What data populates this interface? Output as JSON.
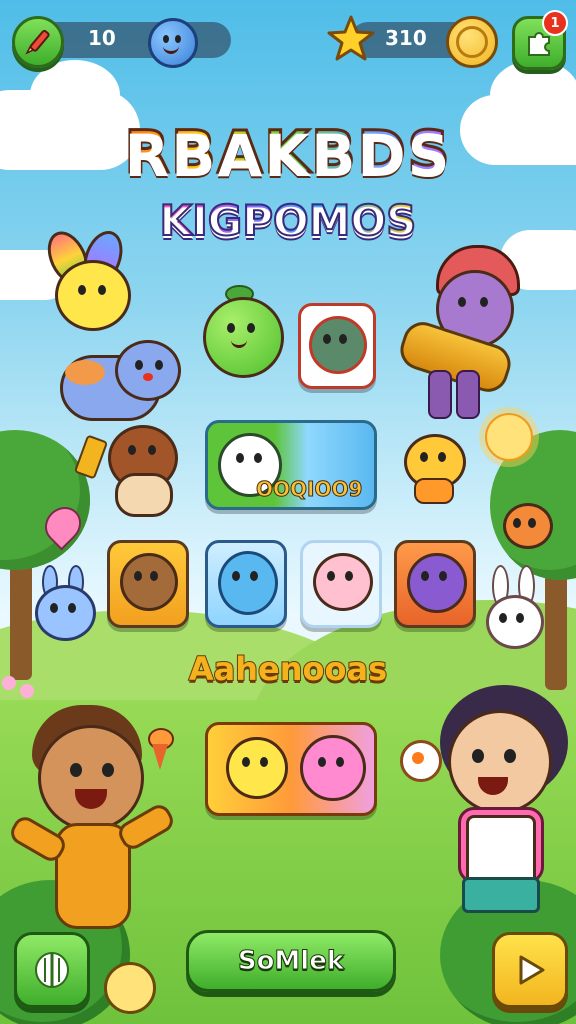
{
  "hud": {
    "left_counter": "10",
    "right_counter": "310",
    "notification_count": "1"
  },
  "titles": {
    "main": "RBAKBDS",
    "sub": "KIGPOMOS"
  },
  "featured_tile": {
    "label": "OOQIOO9"
  },
  "section": {
    "title": "Aahenooas"
  },
  "bottom": {
    "center_button_label": "SoMlek"
  },
  "colors": {
    "sky": "#4fbde8",
    "grass": "#8fd64a",
    "button_green": "#3fae2c",
    "coin_gold": "#f2b51f"
  },
  "icons": [
    "pencil-icon",
    "smiley-ball-icon",
    "star-icon",
    "coin-icon",
    "puzzle-icon",
    "sound-icon",
    "play-icon"
  ]
}
